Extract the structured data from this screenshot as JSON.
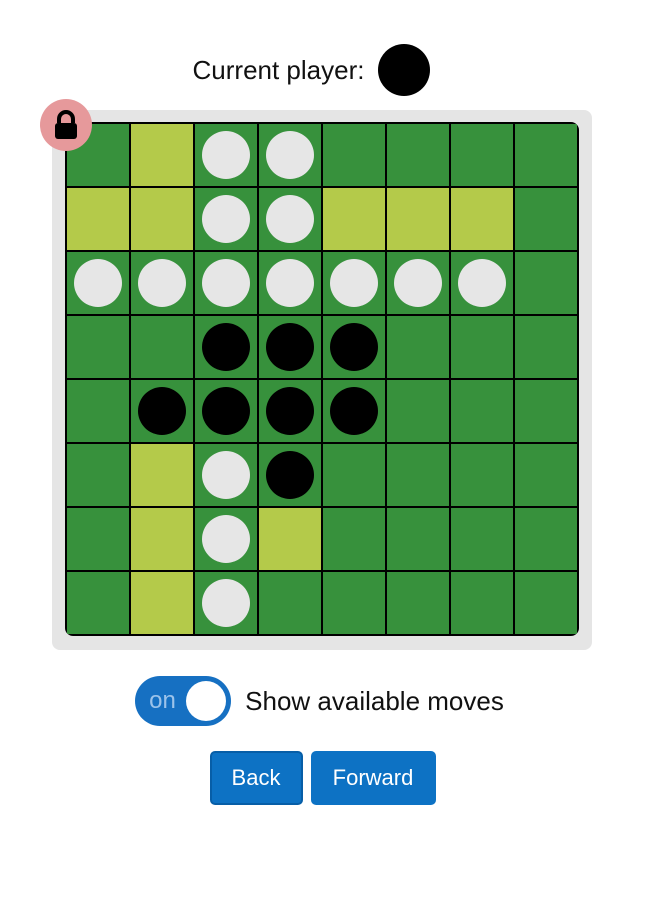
{
  "header": {
    "label": "Current player:",
    "current_player": "black"
  },
  "lock": {
    "icon": "lock-icon"
  },
  "board": {
    "size": 8,
    "rows": [
      [
        "e",
        "h",
        "w",
        "w",
        "e",
        "e",
        "e",
        "e"
      ],
      [
        "h",
        "h",
        "w",
        "w",
        "h",
        "h",
        "h",
        "e"
      ],
      [
        "w",
        "w",
        "w",
        "w",
        "w",
        "w",
        "w",
        "e"
      ],
      [
        "e",
        "e",
        "b",
        "b",
        "b",
        "e",
        "e",
        "e"
      ],
      [
        "e",
        "b",
        "b",
        "b",
        "b",
        "e",
        "e",
        "e"
      ],
      [
        "e",
        "h",
        "w",
        "b",
        "e",
        "e",
        "e",
        "e"
      ],
      [
        "e",
        "h",
        "w",
        "h",
        "e",
        "e",
        "e",
        "e"
      ],
      [
        "e",
        "h",
        "w",
        "e",
        "e",
        "e",
        "e",
        "e"
      ]
    ],
    "legend": {
      "e": "empty",
      "h": "available-move",
      "w": "white-disc",
      "b": "black-disc"
    }
  },
  "toggle": {
    "state_text": "on",
    "label": "Show available moves",
    "checked": true
  },
  "buttons": {
    "back_label": "Back",
    "forward_label": "Forward"
  },
  "colors": {
    "board_green": "#37913c",
    "hint_green": "#b4ca4a",
    "white_disc": "#e6e6e6",
    "black_disc": "#000000",
    "accent_blue": "#0d72c4",
    "lock_badge": "#e6999b"
  }
}
